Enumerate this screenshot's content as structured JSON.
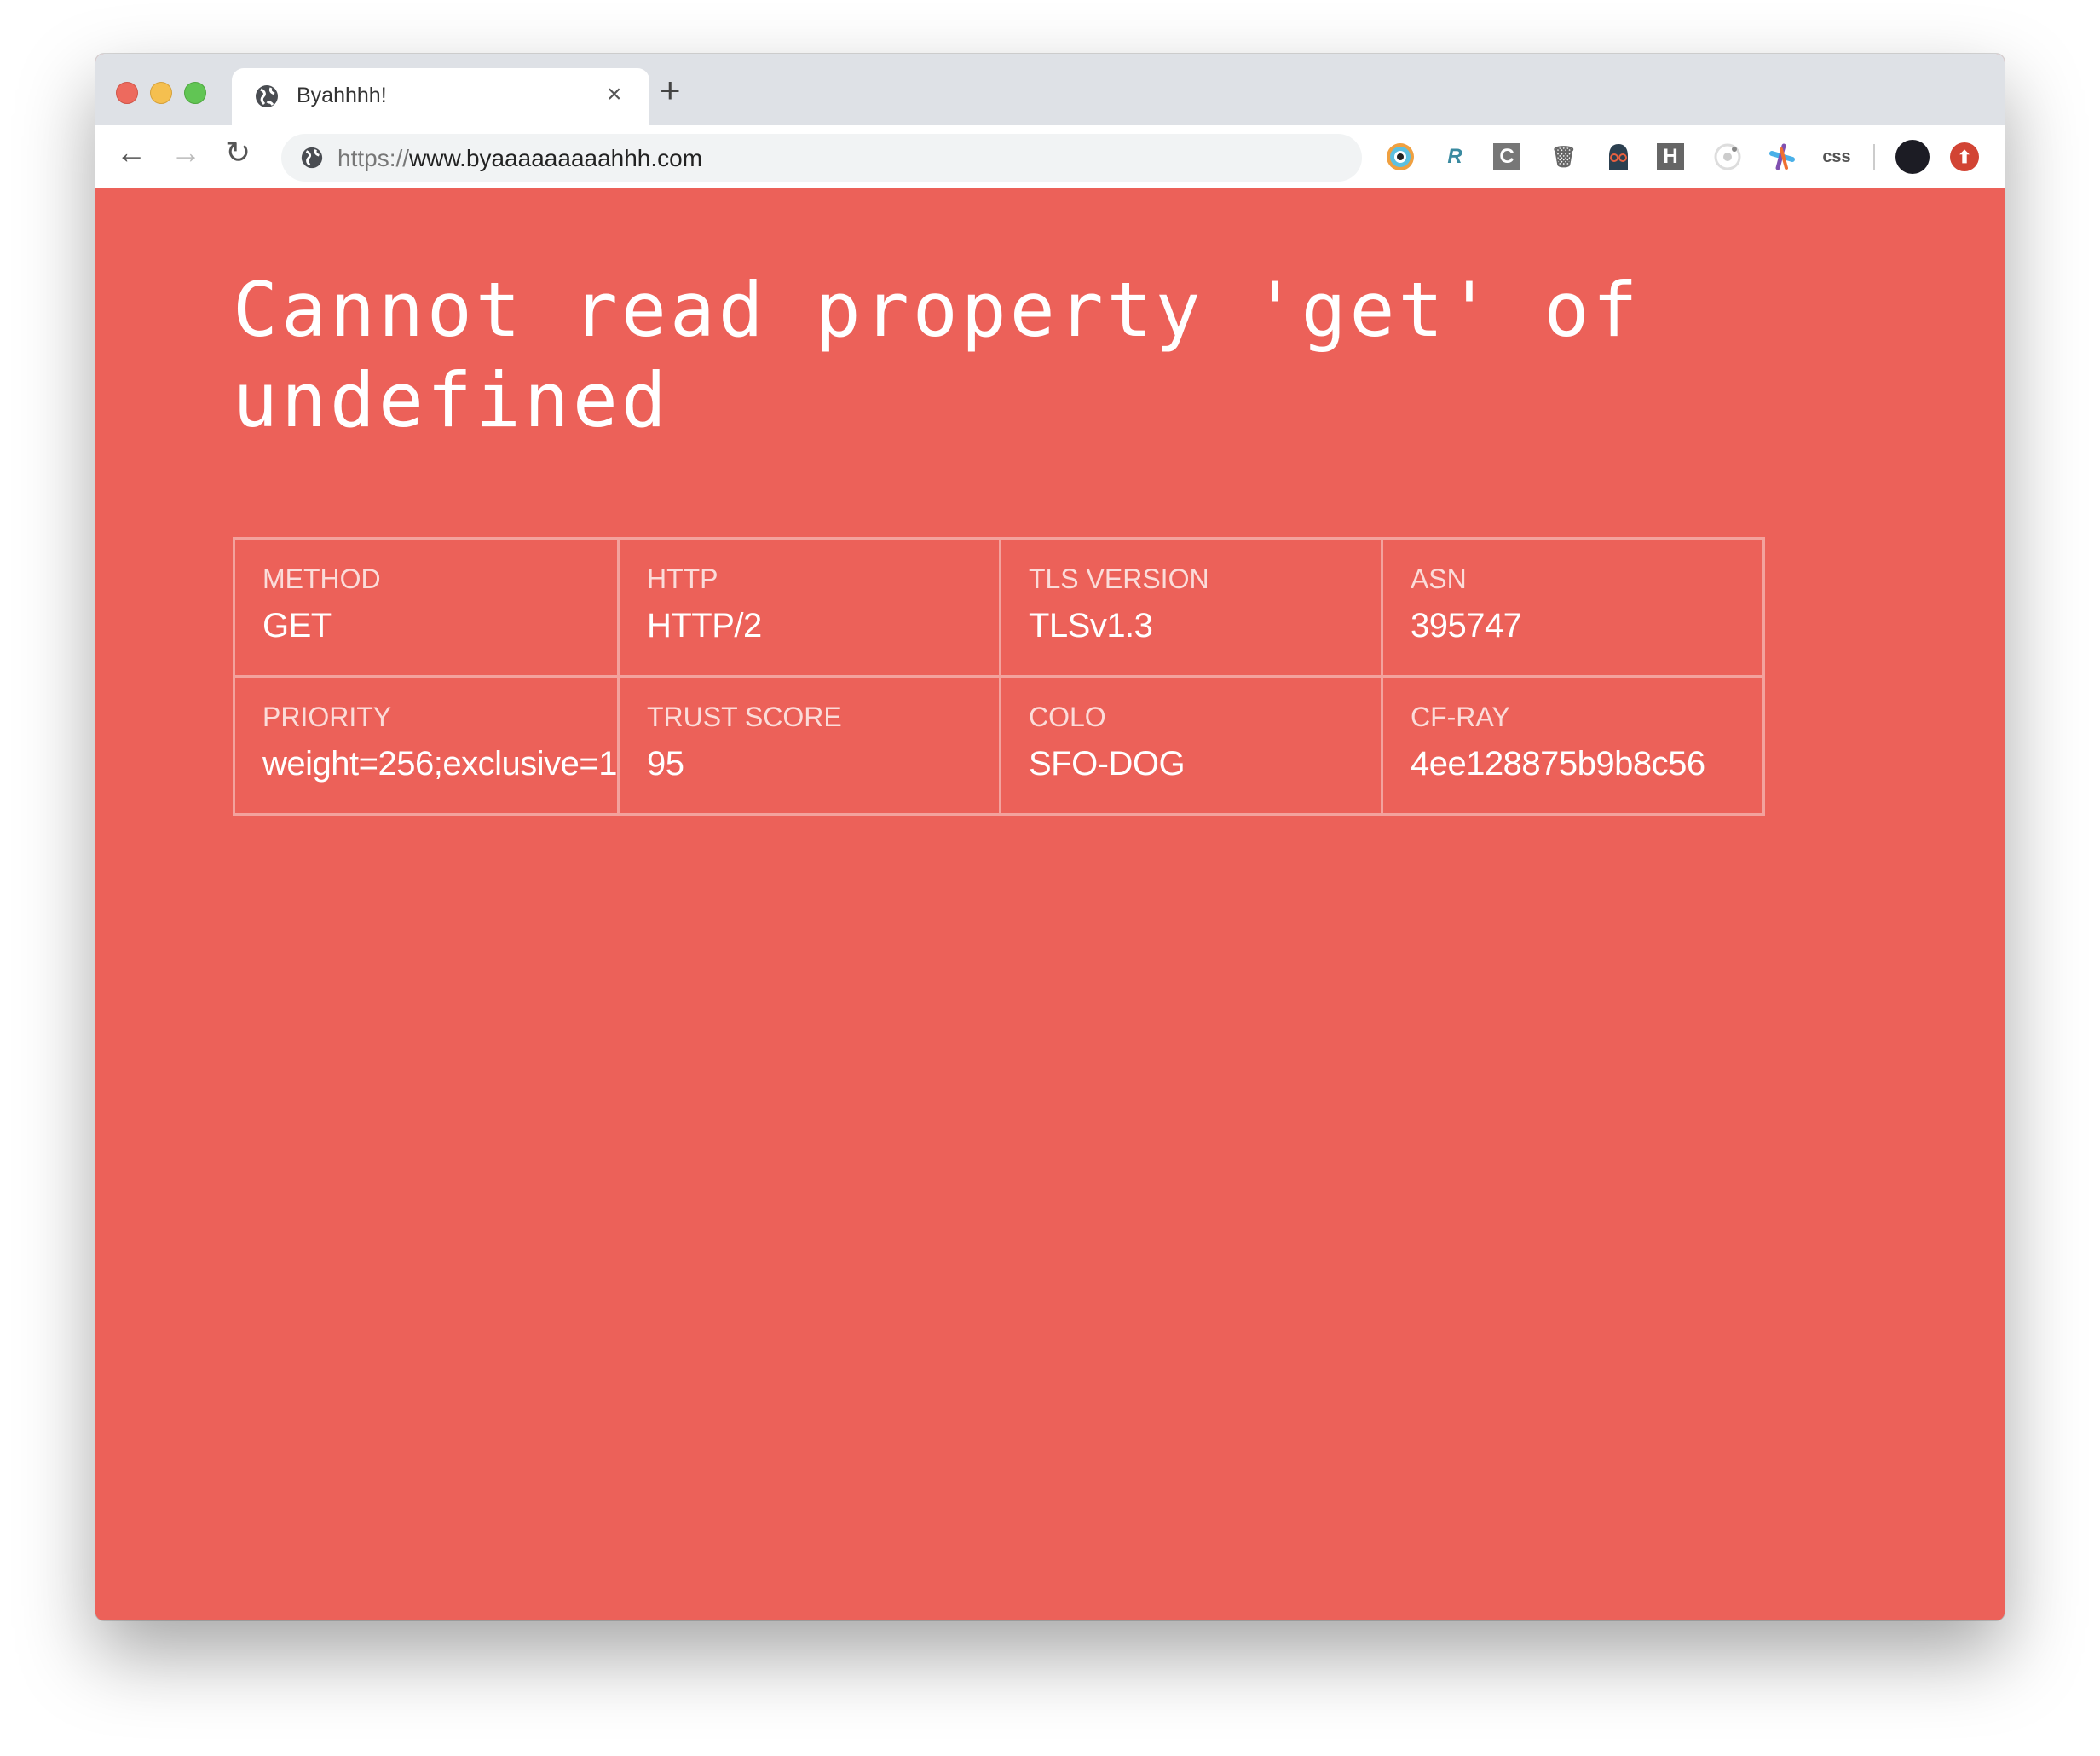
{
  "browser": {
    "tab_title": "Byahhhh!",
    "url_scheme": "https://",
    "url_host": "www.byaaaaaaaaahhh.com",
    "new_tab_label": "+",
    "close_tab_label": "×",
    "extensions": [
      "browser-extension-eye-icon",
      "r-extension-icon",
      "c-extension-icon",
      "trash-extension-icon",
      "darth-extension-icon",
      "h-extension-icon",
      "target-extension-icon",
      "asterisk-extension-icon",
      "css-extension-icon",
      "profile-avatar-icon",
      "upload-extension-icon"
    ],
    "css_ext_label": "css",
    "c_ext_label": "C",
    "h_ext_label": "H"
  },
  "page": {
    "heading": "Cannot read property 'get' of undefined",
    "background": "#ec6159",
    "rows": [
      [
        {
          "label": "METHOD",
          "value": "GET"
        },
        {
          "label": "HTTP",
          "value": "HTTP/2"
        },
        {
          "label": "TLS VERSION",
          "value": "TLSv1.3"
        },
        {
          "label": "ASN",
          "value": "395747"
        }
      ],
      [
        {
          "label": "PRIORITY",
          "value": "weight=256;exclusive=1"
        },
        {
          "label": "TRUST SCORE",
          "value": "95"
        },
        {
          "label": "COLO",
          "value": "SFO-DOG"
        },
        {
          "label": "CF-RAY",
          "value": "4ee128875b9b8c56"
        }
      ]
    ]
  }
}
